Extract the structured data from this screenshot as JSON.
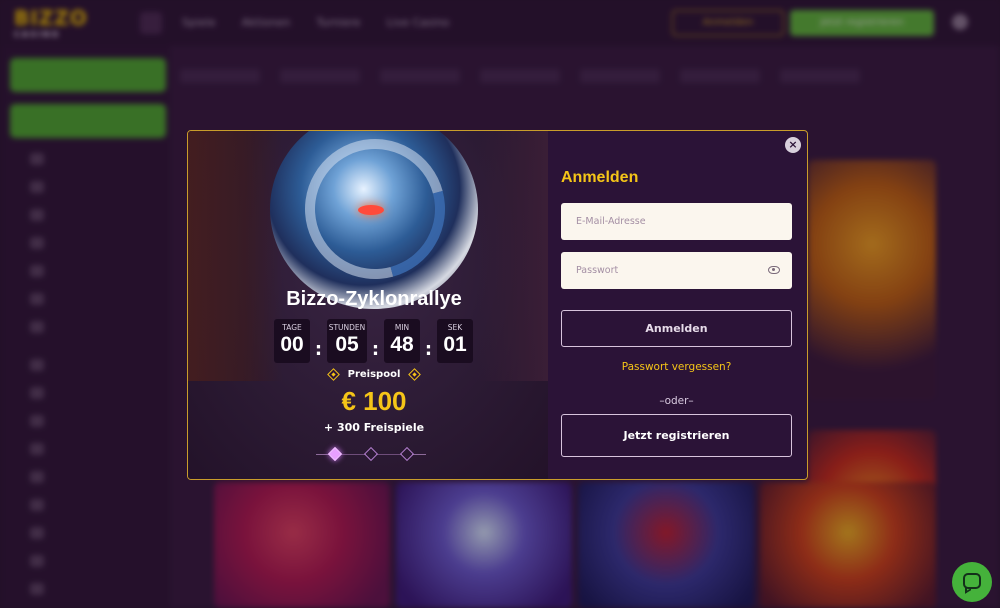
{
  "site": {
    "logo_text": "BIZZO",
    "logo_sub": "CASINO",
    "nav": [
      "Spiele",
      "Aktionen",
      "Turniere",
      "Live Casino"
    ],
    "login_label": "Anmelden",
    "register_label": "Jetzt registrieren"
  },
  "modal": {
    "promo": {
      "title": "Bizzo-Zyklonrallye",
      "countdown": [
        {
          "label": "TAGE",
          "value": "00"
        },
        {
          "label": "STUNDEN",
          "value": "05"
        },
        {
          "label": "MIN",
          "value": "48"
        },
        {
          "label": "SEK",
          "value": "01"
        }
      ],
      "separator": ":",
      "prize_label": "Preispool",
      "prize_amount": "€ 100",
      "prize_extra": "+ 300 Freispiele"
    },
    "form": {
      "title": "Anmelden",
      "email_placeholder": "E-Mail-Adresse",
      "password_placeholder": "Passwort",
      "submit_label": "Anmelden",
      "forgot_label": "Passwort vergessen?",
      "divider": "–oder–",
      "register_label": "Jetzt registrieren"
    },
    "close_glyph": "×"
  },
  "colors": {
    "accent": "#f5c518",
    "primary_green": "#45b23b",
    "modal_bg": "#2b1337",
    "border_gold": "#c99d2b"
  }
}
